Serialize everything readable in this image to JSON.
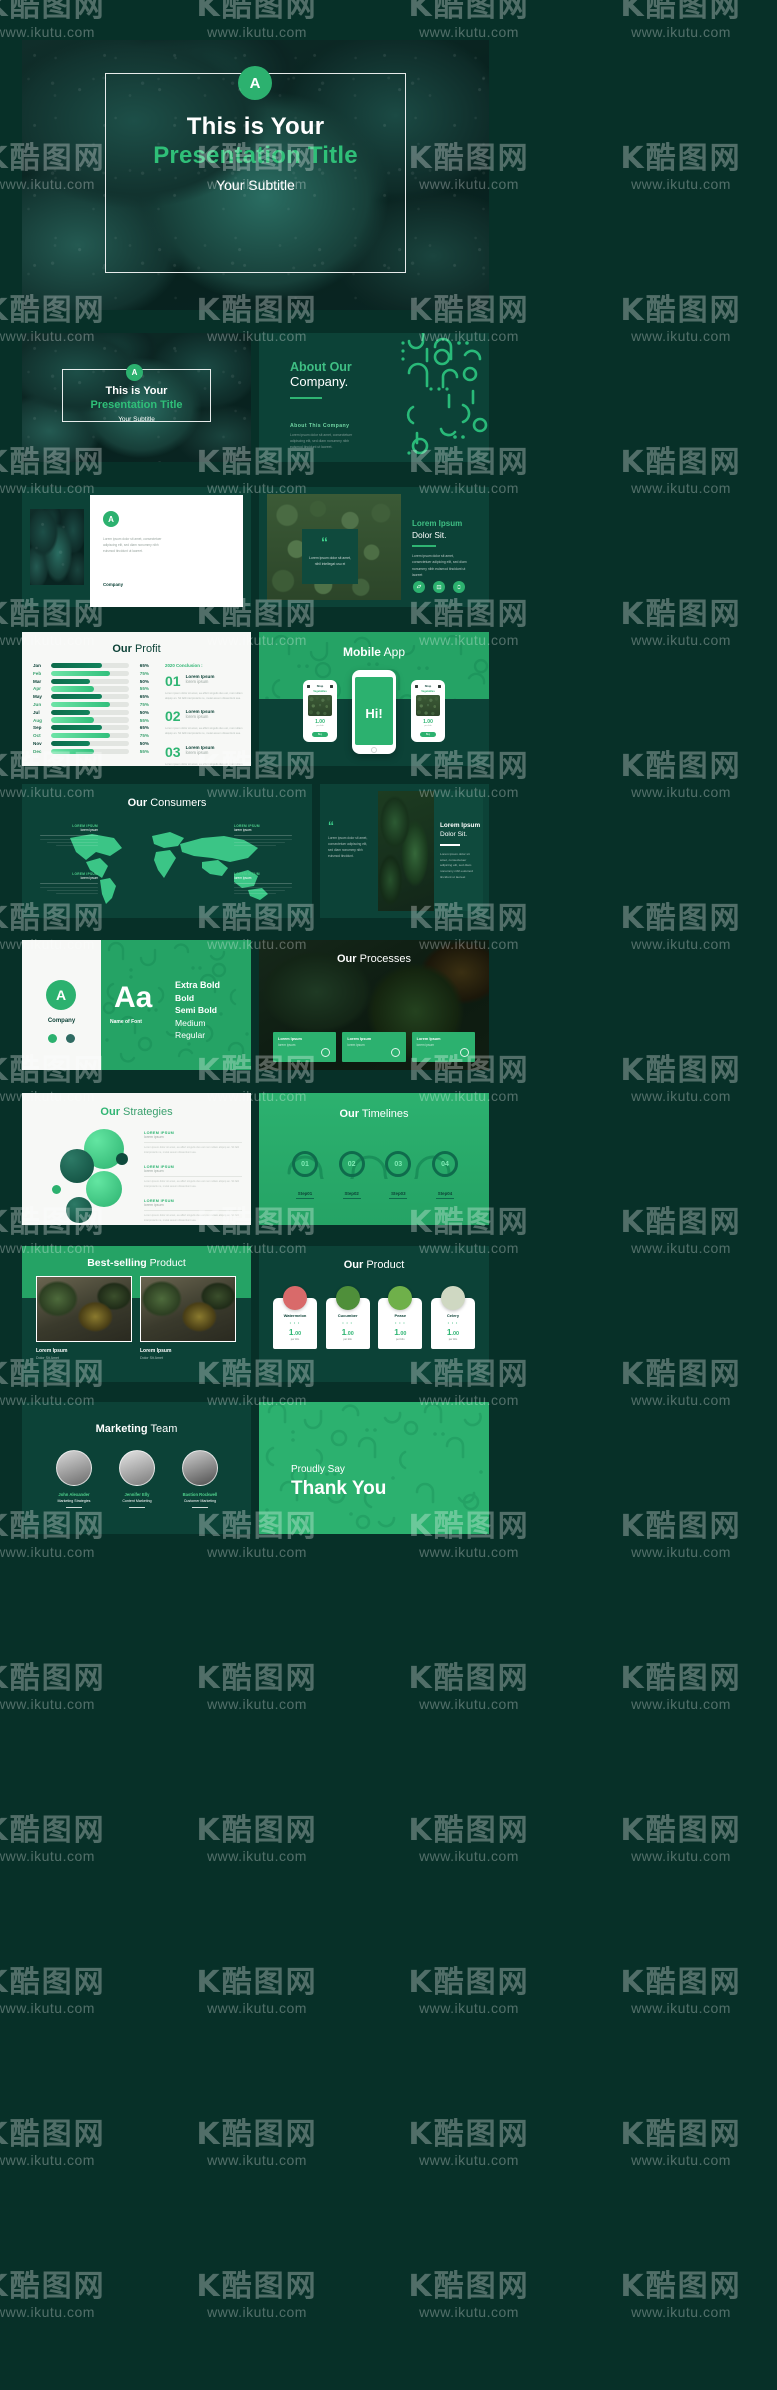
{
  "watermark": {
    "logo": "K酷图网",
    "url": "www.ikutu.com"
  },
  "colors": {
    "page_bg": "#073028",
    "deep_teal": "#0c4237",
    "emerald": "#25a365",
    "bright_green": "#2fb573",
    "light_green": "#4fd18c",
    "cream": "#f7f8f6",
    "white": "#ffffff"
  },
  "slides": {
    "hero": {
      "badge": "A",
      "line1": "This is Your",
      "line2": "Presentation Title",
      "line3": "Your Subtitle"
    },
    "hero_small": {
      "badge": "A",
      "line1": "This is Your",
      "line2": "Presentation Title",
      "line3": "Your Subtitle"
    },
    "about": {
      "title_top": "About Our",
      "title_bottom": "Company.",
      "section_label": "About This Company",
      "body": "Lorem ipsum dolor sit amet, consectetuer adipiscing elit, sed diam nonummy nibh euismod tincidunt ut laoreet."
    },
    "intro_card": {
      "badge": "A",
      "body": "Lorem ipsum dolor sit amet, consectetuer adipiscing elit, sed diam nonummy nibh euismod tincidunt ut laoreet.",
      "footer_label": "Company"
    },
    "quote_dolor": {
      "title_top": "Lorem Ipsum",
      "title_bottom": "Dolor Sit.",
      "quote_mark": "“",
      "quote": "Lorem ipsum dolor sit amet, nihil intellegat usu ei",
      "body": "Lorem ipsum dolor sit amet, consectetuer adipicing elit, sed diam nonummy nibh euismod tincidunt ut laoreet",
      "icons": [
        "leaf-icon",
        "box-icon",
        "recycle-icon"
      ]
    },
    "profit": {
      "title_bold": "Our",
      "title_light": "Profit",
      "conclusion_label": "2020 Conclusion :",
      "items": [
        {
          "num": "01",
          "heading": "Lorem Ipsum",
          "sub": "lorem ipsum",
          "body": "Lorem ipsum dolor sit amet, ea affert singulis duo est, mei nullam aliquip an. Sit falli interpretaris ne, mutat assum dissentiunt sea."
        },
        {
          "num": "02",
          "heading": "Lorem Ipsum",
          "sub": "lorem ipsum",
          "body": "Lorem ipsum dolor sit amet, ea affert singulis duo est, mei nullam aliquip an. Sit falli interpretaris ne, mutat assum dissentiunt sea."
        },
        {
          "num": "03",
          "heading": "Lorem Ipsum",
          "sub": "lorem ipsum",
          "body": "Lorem ipsum dolor sit amet, ea affert singulis duo est, mei nullam aliquip an. Sit falli interpretaris ne, mutat assum dissentiunt sea."
        }
      ]
    },
    "mobile_app": {
      "title_bold": "Mobile",
      "title_light": "App",
      "center_text": "Hi!",
      "side_header": "Shop",
      "side_sub": "Vegetables",
      "price": "1.00",
      "price_unit": "per kilo",
      "cta": "Buy"
    },
    "consumers": {
      "title_bold": "Our",
      "title_light": "Consumers",
      "callouts": [
        {
          "label": "LOREM IPSUM",
          "sub": "lorem ipsum"
        },
        {
          "label": "LOREM IPSUM",
          "sub": "lorem ipsum"
        },
        {
          "label": "LOREM IPSUM",
          "sub": "lorem ipsum"
        },
        {
          "label": "LOREM IPSUM",
          "sub": "lorem ipsum"
        }
      ]
    },
    "quote_leaf": {
      "quote_mark": "“",
      "quote": "Lorem ipsum dolor sit amet, consectetuer adipiscing elit, sed diam nonummy nibh euismod tincidunt.",
      "title_top": "Lorem Ipsum",
      "title_bottom": "Dolor Sit.",
      "body": "Lorem ipsum dolor sit amet, consectetuer adipicing elit, sed diam nonummy nibh euismod tincidunt ut laoreet"
    },
    "typography": {
      "logo_letter": "A",
      "company_label": "Company",
      "specimen": "Aa",
      "font_caption": "Name of Font",
      "weights": [
        "Extra Bold",
        "Bold",
        "Semi Bold",
        "Medium",
        "Regular"
      ],
      "swatches": [
        "#2cb16f",
        "#2f6b63"
      ]
    },
    "processes": {
      "title_bold": "Our",
      "title_light": "Processes",
      "cards": [
        {
          "heading": "Lorem Ipsum",
          "sub": "lorem ipsum",
          "icon": "plant-icon"
        },
        {
          "heading": "Lorem Ipsum",
          "sub": "lorem ipsum",
          "icon": "box-icon"
        },
        {
          "heading": "Lorem Ipsum",
          "sub": "lorem ipsum",
          "icon": "truck-icon"
        }
      ]
    },
    "strategies": {
      "title_bold": "Our",
      "title_light": "Strategies",
      "items": [
        {
          "label": "LOREM IPSUM",
          "sub": "lorem ipsum",
          "body": "Lorem ipsum dolor sit amet, ea affert singulis duo est mei nullam aliquip an. Sit falli interpretaris ne, mutat assum dissentiunt sea."
        },
        {
          "label": "LOREM IPSUM",
          "sub": "lorem ipsum",
          "body": "Lorem ipsum dolor sit amet, ea affert singulis duo est mei nullam aliquip an. Sit falli interpretaris ne, mutat assum dissentiunt sea."
        },
        {
          "label": "LOREM IPSUM",
          "sub": "lorem ipsum",
          "body": "Lorem ipsum dolor sit amet, ea affert singulis duo est mei nullam aliquip an. Sit falli interpretaris ne, mutat assum dissentiunt sea."
        }
      ]
    },
    "timelines": {
      "title_bold": "Our",
      "title_light": "Timelines",
      "steps": [
        {
          "num": "01",
          "label": "Step01"
        },
        {
          "num": "02",
          "label": "Step02"
        },
        {
          "num": "03",
          "label": "Step03"
        },
        {
          "num": "04",
          "label": "Step04"
        }
      ]
    },
    "best_selling": {
      "title_bold": "Best-selling",
      "title_light": "Product",
      "cards": [
        {
          "heading": "Lorem Ipsum",
          "sub": "Dolor Sit Amet"
        },
        {
          "heading": "Lorem Ipsum",
          "sub": "Dolor Sit Amet"
        }
      ]
    },
    "our_product": {
      "title_bold": "Our",
      "title_light": "Product",
      "cards": [
        {
          "name": "Watermelon",
          "dots": "• • •",
          "price": "1",
          "cents": ".00",
          "unit": "per kilo"
        },
        {
          "name": "Cucumber",
          "dots": "• • •",
          "price": "1",
          "cents": ".00",
          "unit": "per kilo"
        },
        {
          "name": "Pease",
          "dots": "• • •",
          "price": "1",
          "cents": ".00",
          "unit": "per kilo"
        },
        {
          "name": "Celery",
          "dots": "• • •",
          "price": "1",
          "cents": ".00",
          "unit": "per kilo"
        }
      ]
    },
    "team": {
      "title_bold": "Marketing",
      "title_light": "Team",
      "members": [
        {
          "name": "John Alexander",
          "role": "Marketing Strategies"
        },
        {
          "name": "Jennifer Elly",
          "role": "Content Marketing"
        },
        {
          "name": "Bastion Rockwell",
          "role": "Customer Marketing"
        }
      ]
    },
    "thank_you": {
      "kicker": "Proudly Say",
      "headline": "Thank You"
    }
  },
  "chart_data": {
    "type": "bar",
    "title": "Our Profit",
    "orientation": "horizontal",
    "categories": [
      "Jan",
      "Feb",
      "Mar",
      "Apr",
      "May",
      "Jun",
      "Jul",
      "Aug",
      "Sep",
      "Oct",
      "Nov",
      "Dec"
    ],
    "values": [
      65,
      75,
      50,
      55,
      65,
      75,
      50,
      55,
      65,
      75,
      50,
      55
    ],
    "value_labels": [
      "65%",
      "75%",
      "50%",
      "55%",
      "65%",
      "75%",
      "50%",
      "55%",
      "65%",
      "75%",
      "50%",
      "55%"
    ],
    "xlabel": "",
    "ylabel": "",
    "xlim": [
      0,
      100
    ],
    "grid": false,
    "legend": false,
    "series_colors": [
      "#0d6b4b",
      "#3ecf86"
    ],
    "track_color": "#e2e5e1"
  }
}
